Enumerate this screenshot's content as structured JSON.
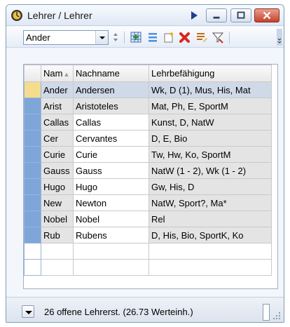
{
  "window": {
    "title": "Lehrer / Lehrer"
  },
  "toolbar": {
    "combo_value": "Ander"
  },
  "table": {
    "columns": [
      "Nam",
      "Nachname",
      "Lehrbefähigung"
    ],
    "rows": [
      {
        "name": "Ander",
        "nachname": "Andersen",
        "lehrbef": "Wk, D (1), Mus, His, Mat"
      },
      {
        "name": "Arist",
        "nachname": "Aristoteles",
        "lehrbef": "Mat, Ph, E, SportM"
      },
      {
        "name": "Callas",
        "nachname": "Callas",
        "lehrbef": "Kunst, D, NatW"
      },
      {
        "name": "Cer",
        "nachname": "Cervantes",
        "lehrbef": "D, E, Bio"
      },
      {
        "name": "Curie",
        "nachname": "Curie",
        "lehrbef": "Tw, Hw, Ko, SportM"
      },
      {
        "name": "Gauss",
        "nachname": "Gauss",
        "lehrbef": "NatW (1 - 2), Wk (1 - 2)"
      },
      {
        "name": "Hugo",
        "nachname": "Hugo",
        "lehrbef": "Gw, His, D"
      },
      {
        "name": "New",
        "nachname": "Newton",
        "lehrbef": "NatW, Sport?, Ma*"
      },
      {
        "name": "Nobel",
        "nachname": "Nobel",
        "lehrbef": "Rel"
      },
      {
        "name": "Rub",
        "nachname": "Rubens",
        "lehrbef": "D, His, Bio, SportK, Ko"
      }
    ]
  },
  "status": {
    "text": "26 offene Lehrerst. (26.73 Werteinh.)"
  }
}
